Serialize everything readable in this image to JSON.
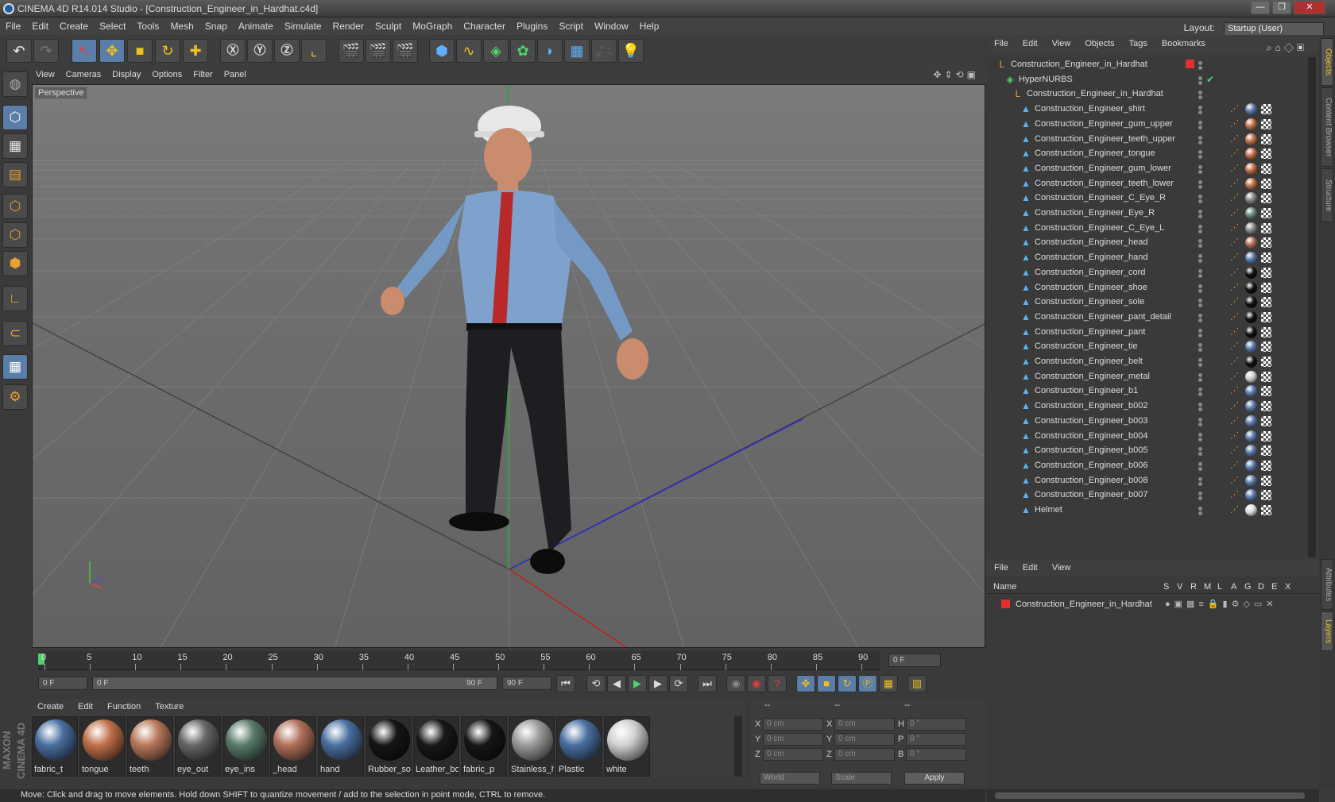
{
  "window": {
    "title": "CINEMA 4D R14.014 Studio - [Construction_Engineer_in_Hardhat.c4d]",
    "minimize": "—",
    "maximize": "❐",
    "close": "✕"
  },
  "menubar": {
    "items": [
      "File",
      "Edit",
      "Create",
      "Select",
      "Tools",
      "Mesh",
      "Snap",
      "Animate",
      "Simulate",
      "Render",
      "Sculpt",
      "MoGraph",
      "Character",
      "Plugins",
      "Script",
      "Window",
      "Help"
    ],
    "layout_label": "Layout:",
    "layout_value": "Startup (User)"
  },
  "viewport": {
    "menu": [
      "View",
      "Cameras",
      "Display",
      "Options",
      "Filter",
      "Panel"
    ],
    "label": "Perspective"
  },
  "timeline": {
    "ticks": [
      "0",
      "5",
      "10",
      "15",
      "20",
      "25",
      "30",
      "35",
      "40",
      "45",
      "50",
      "55",
      "60",
      "65",
      "70",
      "75",
      "80",
      "85",
      "90"
    ],
    "current_frame": "0 F",
    "start_field": "0 F",
    "range_start": "0 F",
    "range_end": "90 F",
    "end_field": "90 F"
  },
  "materials": {
    "menu": [
      "Create",
      "Edit",
      "Function",
      "Texture"
    ],
    "items": [
      {
        "name": "fabric_t",
        "color": "#4a6fa0"
      },
      {
        "name": "tongue",
        "color": "#c0704a"
      },
      {
        "name": "teeth",
        "color": "#b8785a"
      },
      {
        "name": "eye_out",
        "color": "#666666"
      },
      {
        "name": "eye_ins",
        "color": "#5a7a6a"
      },
      {
        "name": "_head",
        "color": "#b0705a"
      },
      {
        "name": "hand",
        "color": "#4a6fa0"
      },
      {
        "name": "Rubber_so",
        "color": "#151515"
      },
      {
        "name": "Leather_bo",
        "color": "#181818"
      },
      {
        "name": "fabric_p",
        "color": "#161616"
      },
      {
        "name": "Stainless_h",
        "color": "#9a9a9a"
      },
      {
        "name": "Plastic",
        "color": "#4a6fa0"
      },
      {
        "name": "white",
        "color": "#d0d0d0"
      }
    ]
  },
  "coords": {
    "header": [
      "--",
      "--",
      "--"
    ],
    "rows": [
      {
        "a": "X",
        "av": "0 cm",
        "b": "X",
        "bv": "0 cm",
        "c": "H",
        "cv": "0 °"
      },
      {
        "a": "Y",
        "av": "0 cm",
        "b": "Y",
        "bv": "0 cm",
        "c": "P",
        "cv": "0 °"
      },
      {
        "a": "Z",
        "av": "0 cm",
        "b": "Z",
        "bv": "0 cm",
        "c": "B",
        "cv": "0 °"
      }
    ],
    "mode1": "World",
    "mode2": "Scale",
    "apply": "Apply"
  },
  "status": "Move: Click and drag to move elements. Hold down SHIFT to quantize movement / add to the selection in point mode, CTRL to remove.",
  "brand": "MAXON CINEMA 4D",
  "objects": {
    "menu": [
      "File",
      "Edit",
      "View",
      "Objects",
      "Tags",
      "Bookmarks"
    ],
    "rows": [
      {
        "name": "Construction_Engineer_in_Hardhat",
        "indent": 0,
        "icon": "null-icon",
        "tags": false
      },
      {
        "name": "HyperNURBS",
        "indent": 1,
        "icon": "hypernurbs-icon",
        "tags": false
      },
      {
        "name": "Construction_Engineer_in_Hardhat",
        "indent": 2,
        "icon": "null-icon",
        "tags": false
      },
      {
        "name": "Construction_Engineer_shirt",
        "indent": 3,
        "icon": "poly-icon",
        "tags": true,
        "mat": "#5a7aa8"
      },
      {
        "name": "Construction_Engineer_gum_upper",
        "indent": 3,
        "icon": "poly-icon",
        "tags": true,
        "mat": "#c0704a"
      },
      {
        "name": "Construction_Engineer_teeth_upper",
        "indent": 3,
        "icon": "poly-icon",
        "tags": true,
        "mat": "#c0704a"
      },
      {
        "name": "Construction_Engineer_tongue",
        "indent": 3,
        "icon": "poly-icon",
        "tags": true,
        "mat": "#c0704a"
      },
      {
        "name": "Construction_Engineer_gum_lower",
        "indent": 3,
        "icon": "poly-icon",
        "tags": true,
        "mat": "#c0704a"
      },
      {
        "name": "Construction_Engineer_teeth_lower",
        "indent": 3,
        "icon": "poly-icon",
        "tags": true,
        "mat": "#c0704a"
      },
      {
        "name": "Construction_Engineer_C_Eye_R",
        "indent": 3,
        "icon": "poly-icon",
        "tags": true,
        "mat": "#888888"
      },
      {
        "name": "Construction_Engineer_Eye_R",
        "indent": 3,
        "icon": "poly-icon",
        "tags": true,
        "mat": "#6a8a7a"
      },
      {
        "name": "Construction_Engineer_C_Eye_L",
        "indent": 3,
        "icon": "poly-icon",
        "tags": true,
        "mat": "#888888"
      },
      {
        "name": "Construction_Engineer_head",
        "indent": 3,
        "icon": "poly-icon",
        "tags": true,
        "mat": "#b0705a"
      },
      {
        "name": "Construction_Engineer_hand",
        "indent": 3,
        "icon": "poly-icon",
        "tags": true,
        "mat": "#5a7aa8"
      },
      {
        "name": "Construction_Engineer_cord",
        "indent": 3,
        "icon": "poly-icon",
        "tags": true,
        "mat": "#111111"
      },
      {
        "name": "Construction_Engineer_shoe",
        "indent": 3,
        "icon": "poly-icon",
        "tags": true,
        "mat": "#111111"
      },
      {
        "name": "Construction_Engineer_sole",
        "indent": 3,
        "icon": "poly-icon",
        "tags": true,
        "mat": "#111111"
      },
      {
        "name": "Construction_Engineer_pant_detail",
        "indent": 3,
        "icon": "poly-icon",
        "tags": true,
        "mat": "#111111"
      },
      {
        "name": "Construction_Engineer_pant",
        "indent": 3,
        "icon": "poly-icon",
        "tags": true,
        "mat": "#111111"
      },
      {
        "name": "Construction_Engineer_tie",
        "indent": 3,
        "icon": "poly-icon",
        "tags": true,
        "mat": "#5a7aa8"
      },
      {
        "name": "Construction_Engineer_belt",
        "indent": 3,
        "icon": "poly-icon",
        "tags": true,
        "mat": "#111111"
      },
      {
        "name": "Construction_Engineer_metal",
        "indent": 3,
        "icon": "poly-icon",
        "tags": true,
        "mat": "#cccccc"
      },
      {
        "name": "Construction_Engineer_b1",
        "indent": 3,
        "icon": "poly-icon",
        "tags": true,
        "mat": "#5a7aa8"
      },
      {
        "name": "Construction_Engineer_b002",
        "indent": 3,
        "icon": "poly-icon",
        "tags": true,
        "mat": "#5a7aa8"
      },
      {
        "name": "Construction_Engineer_b003",
        "indent": 3,
        "icon": "poly-icon",
        "tags": true,
        "mat": "#5a7aa8"
      },
      {
        "name": "Construction_Engineer_b004",
        "indent": 3,
        "icon": "poly-icon",
        "tags": true,
        "mat": "#5a7aa8"
      },
      {
        "name": "Construction_Engineer_b005",
        "indent": 3,
        "icon": "poly-icon",
        "tags": true,
        "mat": "#5a7aa8"
      },
      {
        "name": "Construction_Engineer_b006",
        "indent": 3,
        "icon": "poly-icon",
        "tags": true,
        "mat": "#5a7aa8"
      },
      {
        "name": "Construction_Engineer_b008",
        "indent": 3,
        "icon": "poly-icon",
        "tags": true,
        "mat": "#5a7aa8"
      },
      {
        "name": "Construction_Engineer_b007",
        "indent": 3,
        "icon": "poly-icon",
        "tags": true,
        "mat": "#5a7aa8"
      },
      {
        "name": "Helmet",
        "indent": 3,
        "icon": "poly-icon",
        "tags": true,
        "mat": "#dddddd"
      }
    ]
  },
  "layers": {
    "menu": [
      "File",
      "Edit",
      "View"
    ],
    "columns": [
      "Name",
      "S",
      "V",
      "R",
      "M",
      "L",
      "A",
      "G",
      "D",
      "E",
      "X"
    ],
    "row": "Construction_Engineer_in_Hardhat"
  },
  "side_tabs": [
    "Objects",
    "Content Browser",
    "Structure",
    "Attributes",
    "Layers"
  ]
}
